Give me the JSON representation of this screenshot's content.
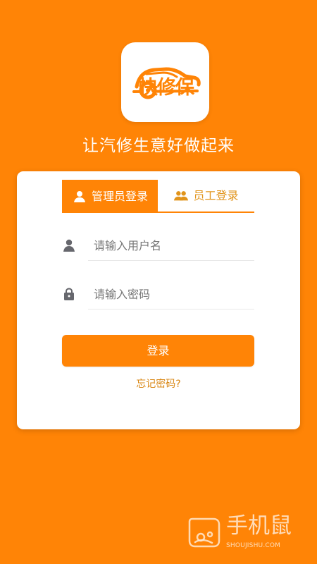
{
  "branding": {
    "logo_text": "快修保",
    "slogan": "让汽修生意好做起来"
  },
  "login": {
    "tabs": [
      {
        "label": "管理员登录",
        "icon": "user-icon",
        "active": true
      },
      {
        "label": "员工登录",
        "icon": "users-icon",
        "active": false
      }
    ],
    "fields": {
      "username": {
        "placeholder": "请输入用户名",
        "value": "",
        "icon": "user-icon"
      },
      "password": {
        "placeholder": "请输入密码",
        "value": "",
        "icon": "lock-icon"
      }
    },
    "submit_label": "登录",
    "forgot_password": "忘记密码?"
  },
  "watermark": {
    "title": "手机鼠",
    "domain": "SHOUJISHU.COM"
  },
  "colors": {
    "background": "#ff8406",
    "card": "#ffffff",
    "accent": "#ff8406",
    "link": "#d98714",
    "icon_gray": "#66676d"
  }
}
